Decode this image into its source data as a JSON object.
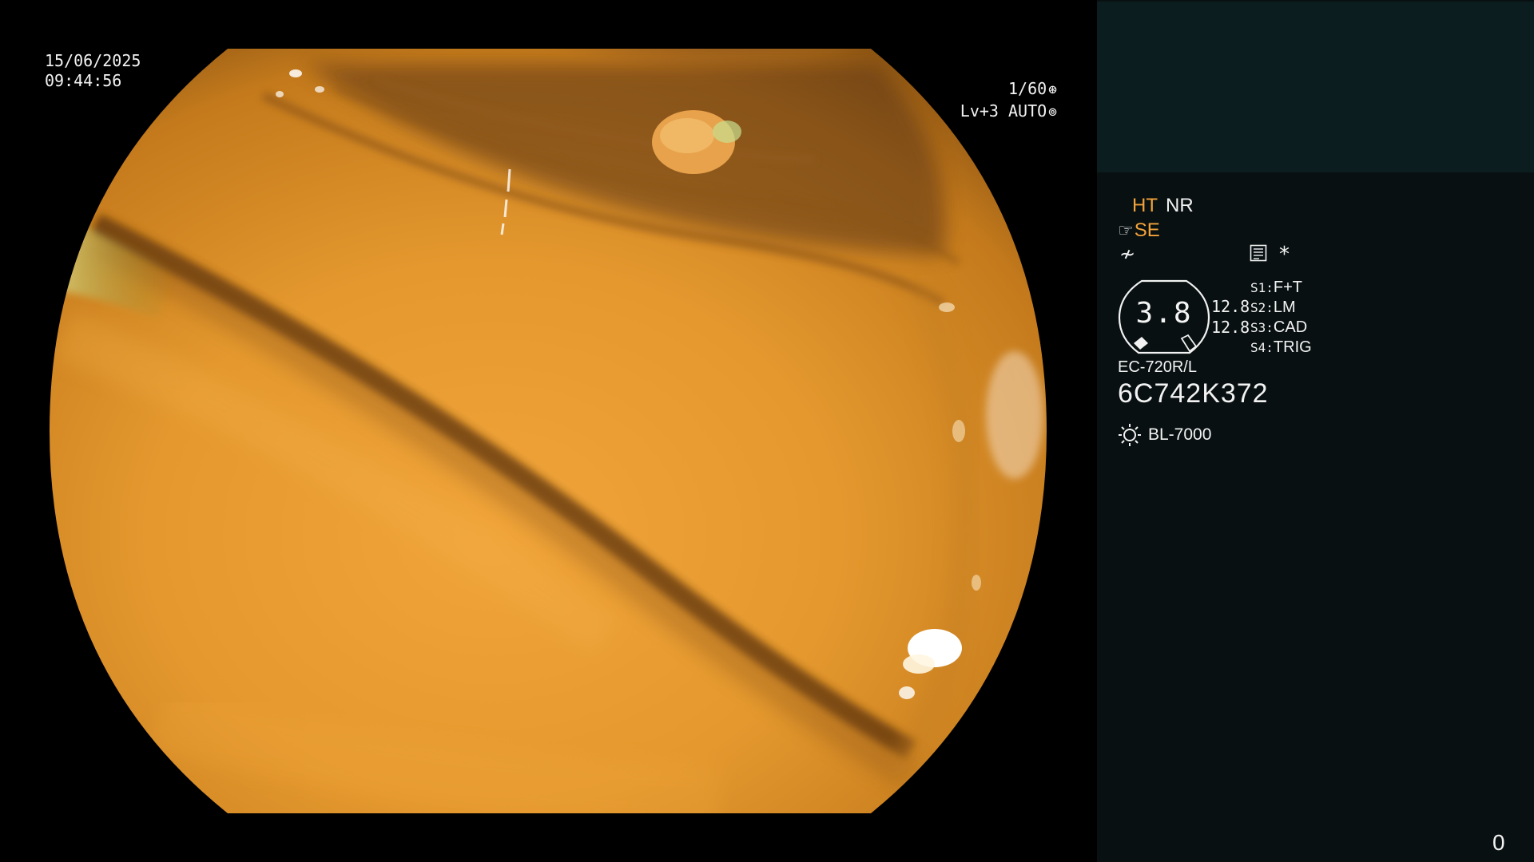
{
  "scope_view": {
    "date": "15/06/2025",
    "time": "09:44:56",
    "shutter": "1/60",
    "shutter_icon": "aperture-icon",
    "level": "Lv+3 AUTO",
    "level_icon": "iris-icon"
  },
  "info_panel": {
    "mode_ht": "HT",
    "mode_nr": "NR",
    "se_label": "SE",
    "zoom_value": "3.8",
    "size_top": "12.8",
    "size_bottom": "12.8",
    "switches": [
      {
        "key": "S1:",
        "value": "F+T"
      },
      {
        "key": "S2:",
        "value": "LM"
      },
      {
        "key": "S3:",
        "value": "CAD"
      },
      {
        "key": "S4:",
        "value": "TRIG"
      }
    ],
    "star": "*",
    "scope_model": "EC-720R/L",
    "scope_serial": "6C742K372",
    "light_source": "BL-7000",
    "counter": "0"
  },
  "colors": {
    "accent_orange": "#f2a23a",
    "panel_bg": "#081011",
    "preview_bg": "#0c1d1f"
  }
}
